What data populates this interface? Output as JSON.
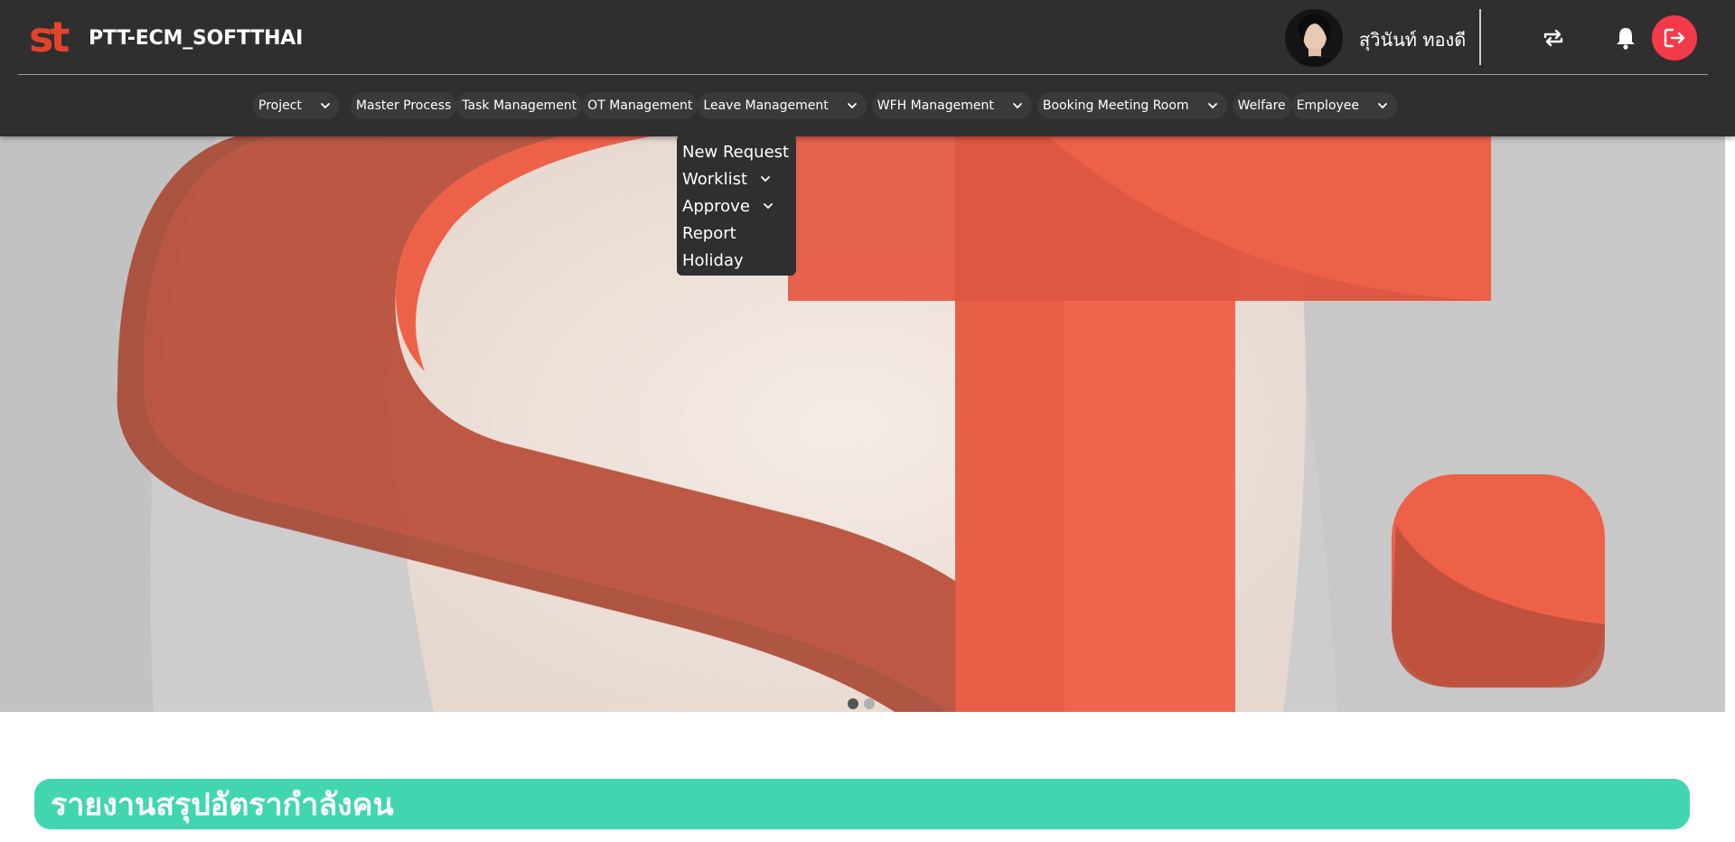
{
  "brand": {
    "name": "PTT-ECM_SOFTTHAI",
    "logo_text": "st",
    "logo_color": "#e2432a"
  },
  "user": {
    "name": "สุวินันท์ ทองดี",
    "switch_icon": "swap-icon",
    "notification_icon": "bell-icon",
    "logout_icon": "logout-icon",
    "logout_color": "#f23a4a"
  },
  "nav": {
    "items": [
      {
        "label": "Project",
        "has_dropdown": true
      },
      {
        "label": "Master Process",
        "has_dropdown": false
      },
      {
        "label": "Task Management",
        "has_dropdown": false
      },
      {
        "label": "OT Management",
        "has_dropdown": false
      },
      {
        "label": "Leave Management",
        "has_dropdown": true
      },
      {
        "label": "WFH Management",
        "has_dropdown": true
      },
      {
        "label": "Booking Meeting Room",
        "has_dropdown": true
      },
      {
        "label": "Welfare",
        "has_dropdown": false
      },
      {
        "label": "Employee",
        "has_dropdown": true
      }
    ]
  },
  "dropdown": {
    "parent": "Leave Management",
    "items": [
      {
        "label": "New Request",
        "has_submenu": false
      },
      {
        "label": "Worklist",
        "has_submenu": true
      },
      {
        "label": "Approve",
        "has_submenu": true
      },
      {
        "label": "Report",
        "has_submenu": false
      },
      {
        "label": "Holiday",
        "has_submenu": false
      }
    ]
  },
  "hero": {
    "accent_color": "#ee6149",
    "carousel": {
      "slides": 2,
      "active_index": 0
    }
  },
  "section": {
    "title": "รายงานสรุปอัตรากำลังคน",
    "color": "#41d6b0"
  }
}
